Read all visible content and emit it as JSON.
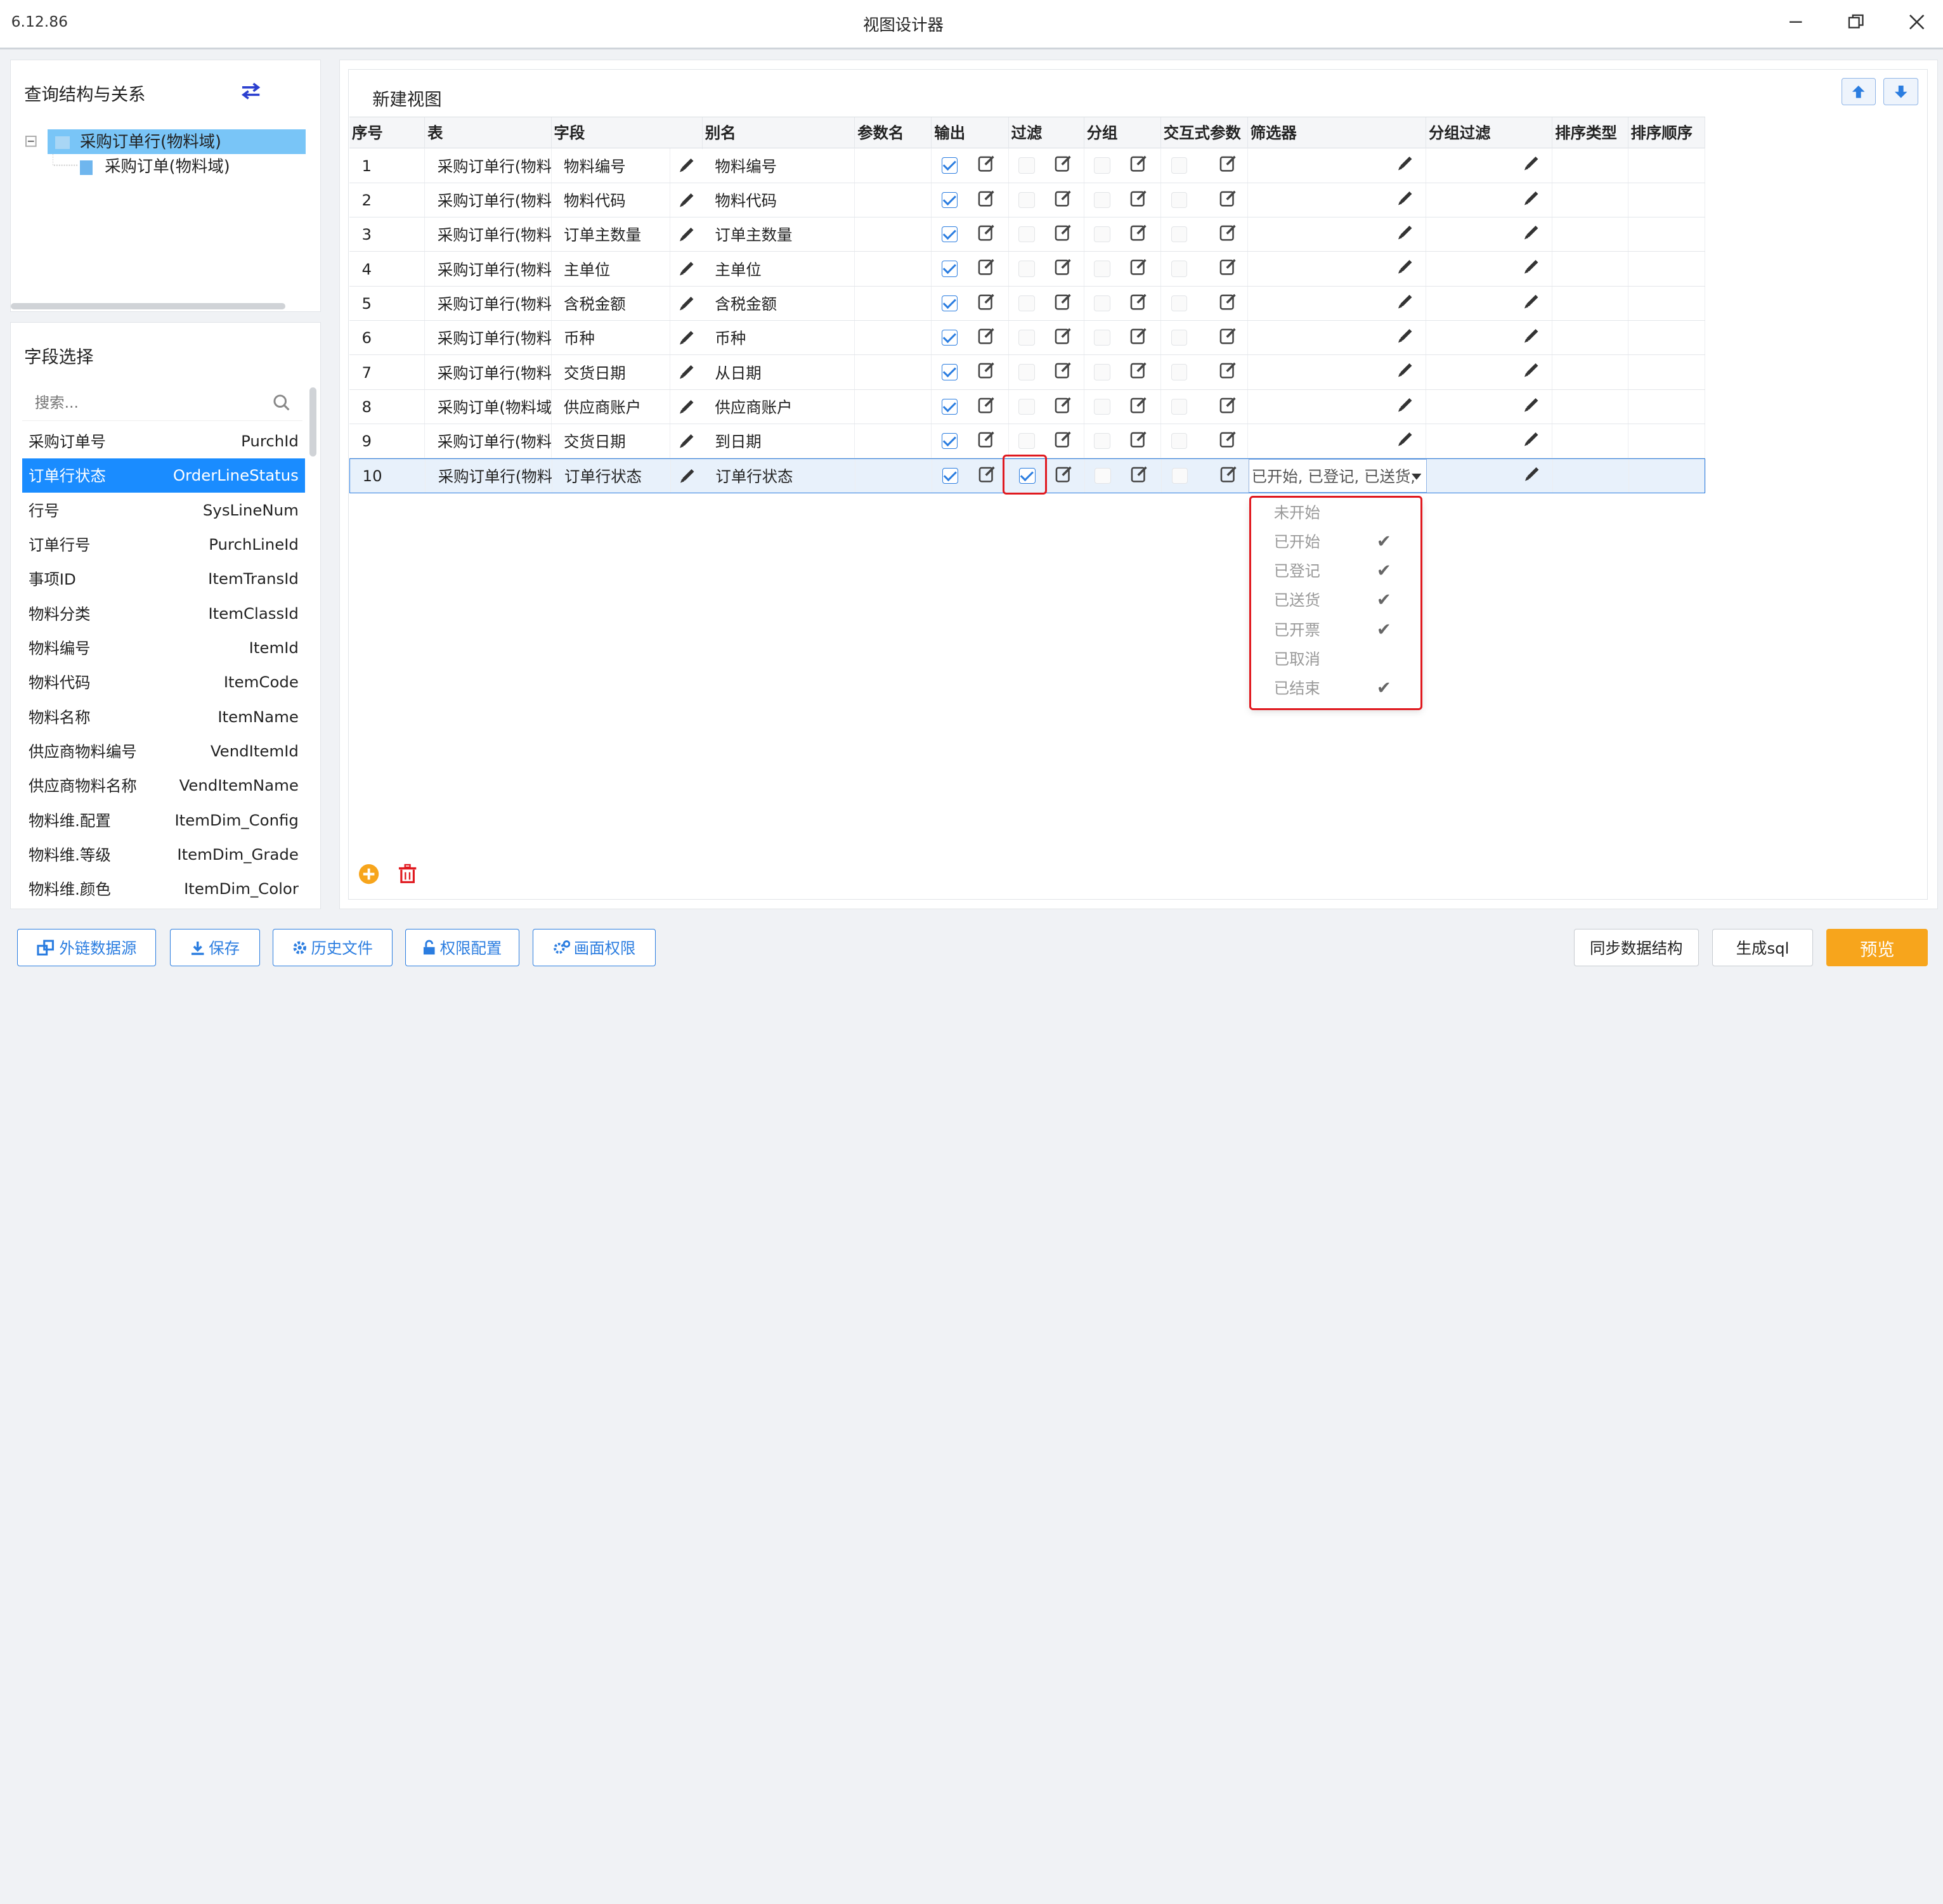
{
  "window": {
    "version": "6.12.86",
    "title": "视图设计器"
  },
  "left_top": {
    "title": "查询结构与关系",
    "tree": [
      {
        "label": "采购订单行(物料域)"
      },
      {
        "label": "采购订单(物料域)"
      }
    ]
  },
  "left_bottom": {
    "title": "字段选择",
    "search_placeholder": "搜索...",
    "fields": [
      {
        "name": "采购订单号",
        "code": "PurchId"
      },
      {
        "name": "订单行状态",
        "code": "OrderLineStatus"
      },
      {
        "name": "行号",
        "code": "SysLineNum"
      },
      {
        "name": "订单行号",
        "code": "PurchLineId"
      },
      {
        "name": "事项ID",
        "code": "ItemTransId"
      },
      {
        "name": "物料分类",
        "code": "ItemClassId"
      },
      {
        "name": "物料编号",
        "code": "ItemId"
      },
      {
        "name": "物料代码",
        "code": "ItemCode"
      },
      {
        "name": "物料名称",
        "code": "ItemName"
      },
      {
        "name": "供应商物料编号",
        "code": "VendItemId"
      },
      {
        "name": "供应商物料名称",
        "code": "VendItemName"
      },
      {
        "name": "物料维.配置",
        "code": "ItemDim_Config"
      },
      {
        "name": "物料维.等级",
        "code": "ItemDim_Grade"
      },
      {
        "name": "物料维.颜色",
        "code": "ItemDim_Color"
      }
    ]
  },
  "main": {
    "title": "新建视图",
    "columns": [
      "序号",
      "表",
      "字段",
      "别名",
      "参数名",
      "输出",
      "过滤",
      "分组",
      "交互式参数",
      "筛选器",
      "分组过滤",
      "排序类型",
      "排序顺序"
    ],
    "rows": [
      {
        "no": "1",
        "table": "采购订单行(物料",
        "field": "物料编号",
        "alias": "物料编号",
        "output": true,
        "filter": false
      },
      {
        "no": "2",
        "table": "采购订单行(物料",
        "field": "物料代码",
        "alias": "物料代码",
        "output": true,
        "filter": false
      },
      {
        "no": "3",
        "table": "采购订单行(物料",
        "field": "订单主数量",
        "alias": "订单主数量",
        "output": true,
        "filter": false
      },
      {
        "no": "4",
        "table": "采购订单行(物料",
        "field": "主单位",
        "alias": "主单位",
        "output": true,
        "filter": false
      },
      {
        "no": "5",
        "table": "采购订单行(物料",
        "field": "含税金额",
        "alias": "含税金额",
        "output": true,
        "filter": false
      },
      {
        "no": "6",
        "table": "采购订单行(物料",
        "field": "币种",
        "alias": "币种",
        "output": true,
        "filter": false
      },
      {
        "no": "7",
        "table": "采购订单行(物料",
        "field": "交货日期",
        "alias": "从日期",
        "output": true,
        "filter": false
      },
      {
        "no": "8",
        "table": "采购订单(物料域",
        "field": "供应商账户",
        "alias": "供应商账户",
        "output": true,
        "filter": false
      },
      {
        "no": "9",
        "table": "采购订单行(物料",
        "field": "交货日期",
        "alias": "到日期",
        "output": true,
        "filter": false
      },
      {
        "no": "10",
        "table": "采购订单行(物料",
        "field": "订单行状态",
        "alias": "订单行状态",
        "output": true,
        "filter": true,
        "filter_value": "已开始, 已登记, 已送货,"
      }
    ],
    "dropdown_options": [
      {
        "label": "未开始",
        "checked": false
      },
      {
        "label": "已开始",
        "checked": true
      },
      {
        "label": "已登记",
        "checked": true
      },
      {
        "label": "已送货",
        "checked": true
      },
      {
        "label": "已开票",
        "checked": true
      },
      {
        "label": "已取消",
        "checked": false
      },
      {
        "label": "已结束",
        "checked": true
      }
    ]
  },
  "bottom": {
    "ext_source": "外链数据源",
    "save": "保存",
    "history": "历史文件",
    "permission": "权限配置",
    "screen_permission": "画面权限",
    "sync": "同步数据结构",
    "gen_sql": "生成sql",
    "preview": "预览"
  },
  "colors": {
    "accent": "#2b7de0",
    "selected": "#1a8cff",
    "highlight": "#e0191f",
    "preview": "#f7a51c"
  }
}
